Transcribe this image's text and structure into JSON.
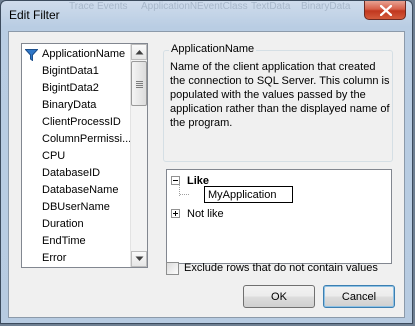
{
  "window": {
    "title": "Edit Filter",
    "background_ghost_text": [
      "Trace Events",
      "ApplicationN",
      "EventClass",
      "TextData",
      "BinaryData"
    ]
  },
  "columns_list": {
    "selected": "ApplicationName",
    "items": [
      "ApplicationName",
      "BigintData1",
      "BigintData2",
      "BinaryData",
      "ClientProcessID",
      "ColumnPermissi...",
      "CPU",
      "DatabaseID",
      "DatabaseName",
      "DBUserName",
      "Duration",
      "EndTime",
      "Error"
    ]
  },
  "description": {
    "heading": "ApplicationName",
    "text": "Name of the client application that created the connection to SQL Server. This column is populated with the values passed by the application rather than the displayed name of the program."
  },
  "filter_tree": {
    "like_label": "Like",
    "like_value": "MyApplication",
    "not_like_label": "Not like"
  },
  "exclude_option": {
    "label": "Exclude rows that do not contain values",
    "checked": false
  },
  "buttons": {
    "ok": "OK",
    "cancel": "Cancel"
  },
  "icons": {
    "filter": "filter-funnel-icon",
    "close": "close-icon",
    "expand": "tree-expander-plus-icon",
    "collapse": "tree-expander-minus-icon"
  },
  "colors": {
    "title_bar": "#cfdcec",
    "close_button": "#c1371f",
    "filter_icon": "#2f77c8",
    "default_button_border": "#3c7fb1"
  }
}
